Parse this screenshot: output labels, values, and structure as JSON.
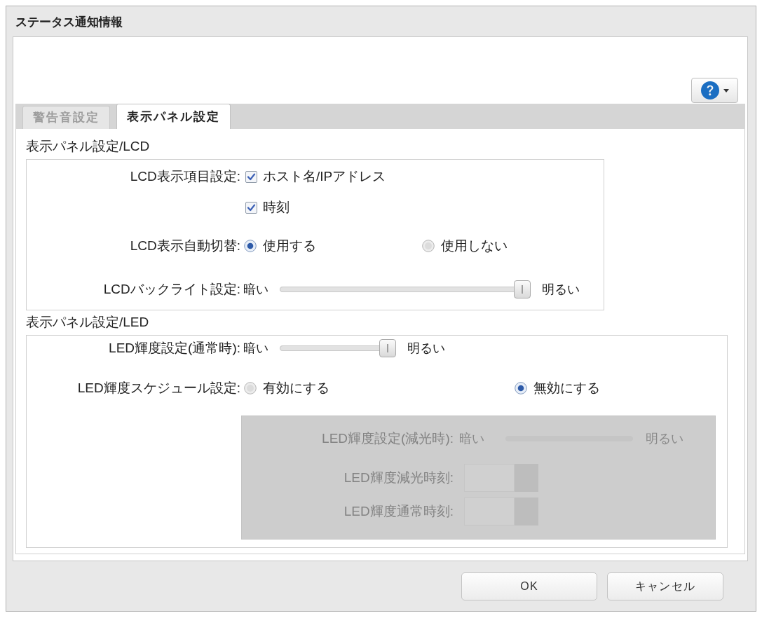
{
  "window": {
    "title": "ステータス通知情報"
  },
  "tabs": [
    {
      "label": "警告音設定",
      "selected": false
    },
    {
      "label": "表示パネル設定",
      "selected": true
    }
  ],
  "sections": [
    {
      "title": "表示パネル設定/LCD",
      "rows": [
        {
          "kind": "checkbox",
          "label": "LCD表示項目設定:",
          "options": [
            {
              "label": "ホスト名/IPアドレス",
              "checked": true
            },
            {
              "label": "時刻",
              "checked": true
            }
          ]
        },
        {
          "kind": "radio",
          "label": "LCD表示自動切替:",
          "options": [
            {
              "label": "使用する",
              "selected": true
            },
            {
              "label": "使用しない",
              "selected": false
            }
          ]
        },
        {
          "kind": "slider",
          "label": "LCDバックライト設定:",
          "min_label": "暗い",
          "max_label": "明るい",
          "level": 1
        }
      ]
    },
    {
      "title": "表示パネル設定/LED",
      "rows": [
        {
          "kind": "slider",
          "label": "LED輝度設定(通常時):",
          "min_label": "暗い",
          "max_label": "明るい",
          "level": 1
        },
        {
          "kind": "radio",
          "label": "LED輝度スケジュール設定:",
          "options": [
            {
              "label": "有効にする",
              "selected": false
            },
            {
              "label": "無効にする",
              "selected": true
            }
          ]
        }
      ],
      "subpanel": {
        "disabled": true,
        "rows": [
          {
            "kind": "slider",
            "label": "LED輝度設定(減光時):",
            "min_label": "暗い",
            "max_label": "明るい"
          },
          {
            "kind": "spinner",
            "label": "LED輝度減光時刻:"
          },
          {
            "kind": "spinner",
            "label": "LED輝度通常時刻:"
          }
        ]
      }
    }
  ],
  "buttons": [
    "OK",
    "キャンセル"
  ]
}
